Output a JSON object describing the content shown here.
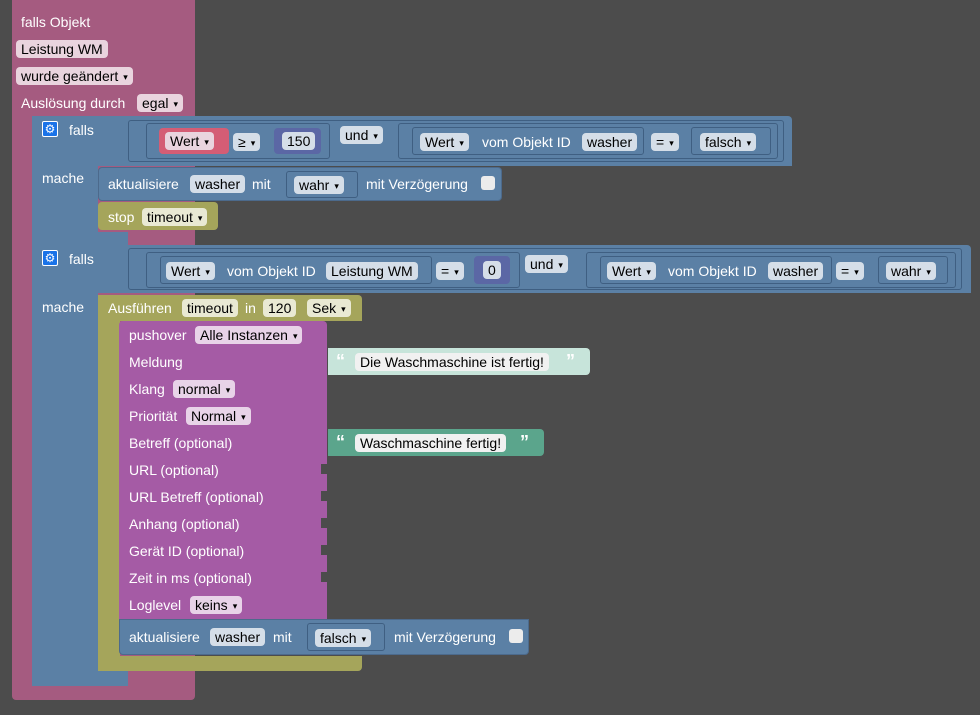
{
  "event_block": {
    "label": "falls Objekt",
    "object": "Leistung WM",
    "condition": "wurde geändert",
    "trigger_label": "Auslösung durch",
    "trigger_value": "egal"
  },
  "if1": {
    "label": "falls",
    "cmp1": {
      "left": "Wert",
      "op": "≥",
      "right": "150"
    },
    "logic": "und",
    "cmp2": {
      "left": "Wert",
      "mid": "vom Objekt ID",
      "obj": "washer",
      "op": "=",
      "right": "falsch"
    },
    "do_label": "mache",
    "update": {
      "label": "aktualisiere",
      "obj": "washer",
      "with": "mit",
      "value": "wahr",
      "delay": "mit Verzögerung"
    },
    "stop": {
      "label": "stop",
      "value": "timeout"
    }
  },
  "if2": {
    "label": "falls",
    "cmp1": {
      "left": "Wert",
      "mid": "vom Objekt ID",
      "obj": "Leistung WM",
      "op": "=",
      "right": "0"
    },
    "logic": "und",
    "cmp2": {
      "left": "Wert",
      "mid": "vom Objekt ID",
      "obj": "washer",
      "op": "=",
      "right": "wahr"
    },
    "do_label": "mache",
    "timeout": {
      "label": "Ausführen",
      "name": "timeout",
      "in": "in",
      "value": "120",
      "unit": "Sek"
    },
    "pushover": {
      "label": "pushover",
      "instance": "Alle Instanzen",
      "message_label": "Meldung",
      "message": "Die Waschmaschine ist fertig!",
      "sound_label": "Klang",
      "sound": "normal",
      "priority_label": "Priorität",
      "priority": "Normal",
      "subject_label": "Betreff (optional)",
      "subject": "Waschmaschine fertig!",
      "url_label": "URL (optional)",
      "url_subject_label": "URL Betreff (optional)",
      "attachment_label": "Anhang (optional)",
      "device_label": "Gerät ID (optional)",
      "time_label": "Zeit in ms (optional)",
      "loglevel_label": "Loglevel",
      "loglevel": "keins"
    },
    "update": {
      "label": "aktualisiere",
      "obj": "washer",
      "with": "mit",
      "value": "falsch",
      "delay": "mit Verzögerung"
    }
  },
  "quote_open": "“",
  "quote_close": "”",
  "dropdown_arrow": "▾",
  "icons": {
    "gear": "gear-icon"
  },
  "colors": {
    "event": "#a55b80",
    "logic": "#5b80a5",
    "timeout": "#a5a55b",
    "pushover": "#a55ba5",
    "text": "#5ba58c",
    "number": "#5b67a5",
    "workspace": "#4c4c4c"
  }
}
